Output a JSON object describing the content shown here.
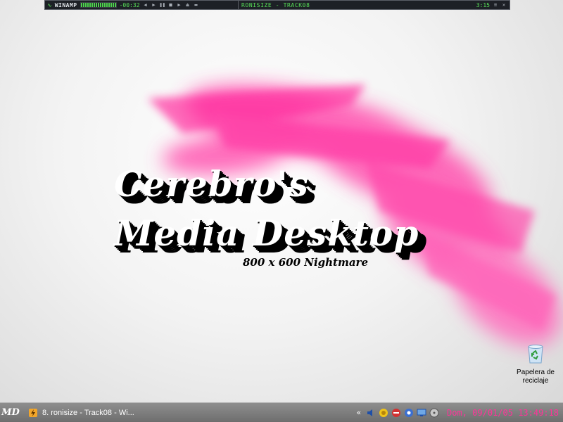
{
  "winamp": {
    "logo": "WINAMP",
    "elapsed": "-00:32",
    "track": "RONISIZE - TRACK08",
    "track_time": "3:15",
    "controls": [
      "prev-icon",
      "play-icon",
      "pause-icon",
      "stop-icon",
      "next-icon",
      "eject-icon"
    ],
    "window_buttons": [
      "minimize-icon",
      "close-icon"
    ]
  },
  "desktop": {
    "title_line1": "Cerebro's",
    "title_line2": "Media Desktop",
    "subtitle": "800 x 600 Nightmare",
    "accent_color": "#ff3ea6",
    "icons": [
      {
        "label_line1": "Papelera de",
        "label_line2": "reciclaje",
        "icon": "recycle-bin-icon"
      }
    ]
  },
  "taskbar": {
    "start_label": "MD",
    "task_label": "8. ronisize - Track08 - Wi...",
    "tray_expand": "«",
    "tray_icons": [
      "speaker-icon",
      "network-icon",
      "shield-icon",
      "antivirus-icon",
      "monitor-icon",
      "disk-icon"
    ],
    "clock": "Dom, 09/01/05 13:49:18",
    "clock_color": "#ff3399"
  }
}
